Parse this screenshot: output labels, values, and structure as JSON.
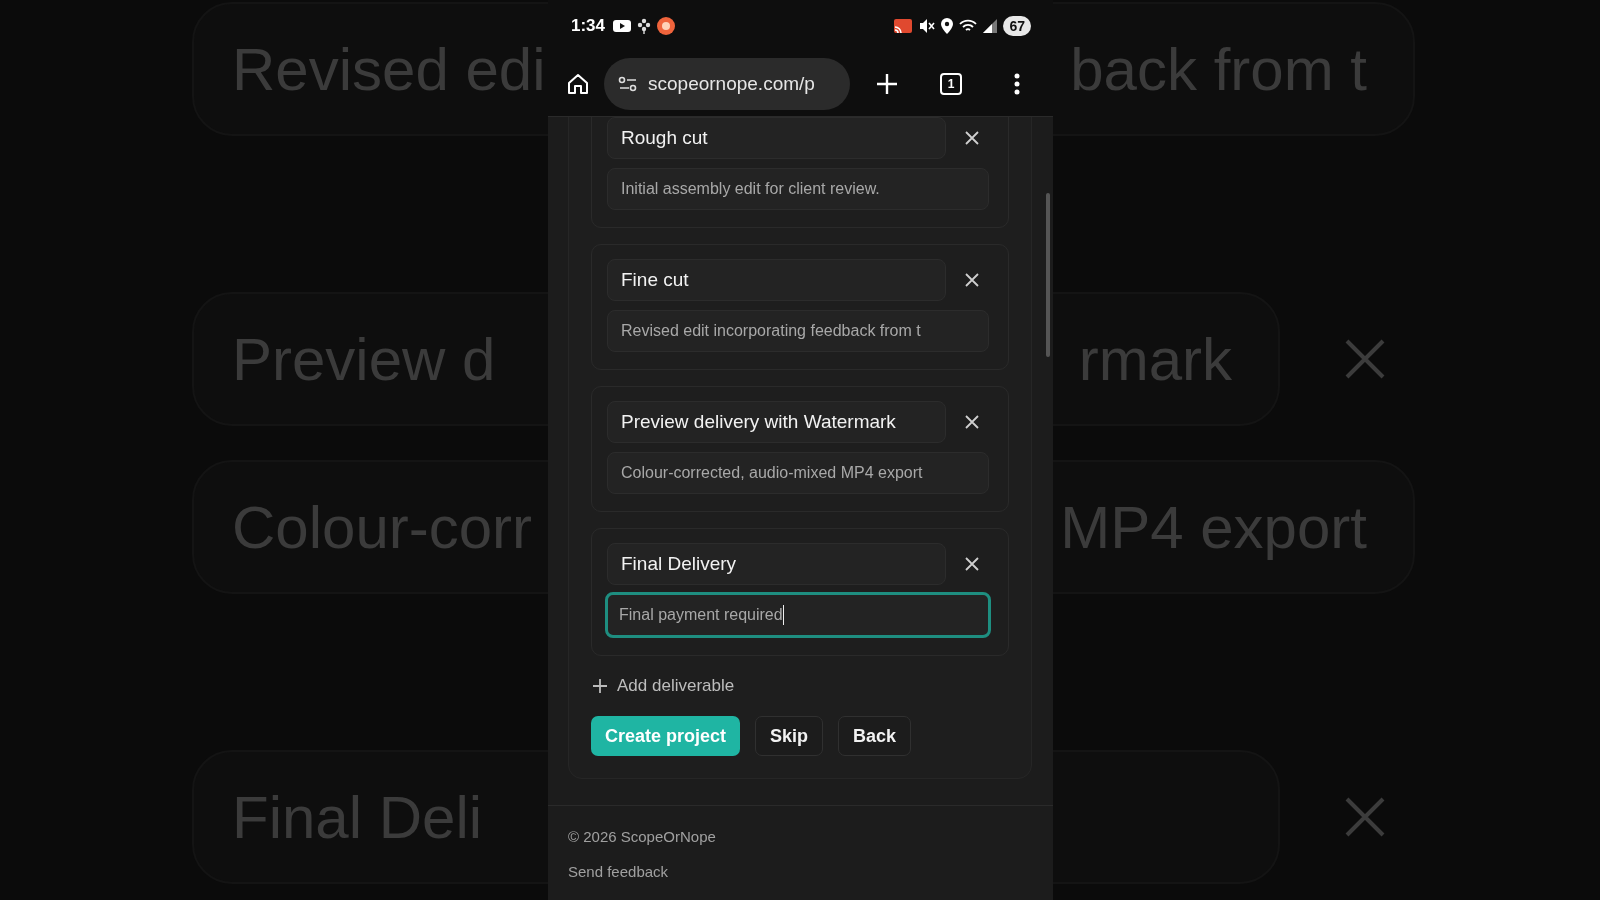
{
  "backdrop": [
    {
      "kind": "description",
      "left": "Revised edi",
      "right": "back from t"
    },
    {
      "kind": "title",
      "left": "Preview d",
      "right": "rmark"
    },
    {
      "kind": "description",
      "left": "Colour-corr",
      "right": "MP4 export"
    },
    {
      "kind": "title",
      "left": "Final Deli"
    }
  ],
  "status_bar": {
    "time": "1:34",
    "battery": "67"
  },
  "browser": {
    "url": "scopeornope.com/p",
    "tab_count": "1"
  },
  "deliverables": [
    {
      "title": "Rough cut",
      "description": "Initial assembly edit for client review.",
      "focused": false
    },
    {
      "title": "Fine cut",
      "description": "Revised edit incorporating feedback from t",
      "focused": false
    },
    {
      "title": "Preview delivery with Watermark",
      "description": "Colour-corrected, audio-mixed MP4 export",
      "focused": false
    },
    {
      "title": "Final Delivery",
      "description": "Final payment required",
      "focused": true
    }
  ],
  "add_button": "Add deliverable",
  "buttons": [
    {
      "label": "Create project",
      "kind": "primary"
    },
    {
      "label": "Skip",
      "kind": "secondary"
    },
    {
      "label": "Back",
      "kind": "secondary"
    }
  ],
  "footer": {
    "copyright": "© 2026 ScopeOrNope",
    "link": "Send feedback"
  }
}
